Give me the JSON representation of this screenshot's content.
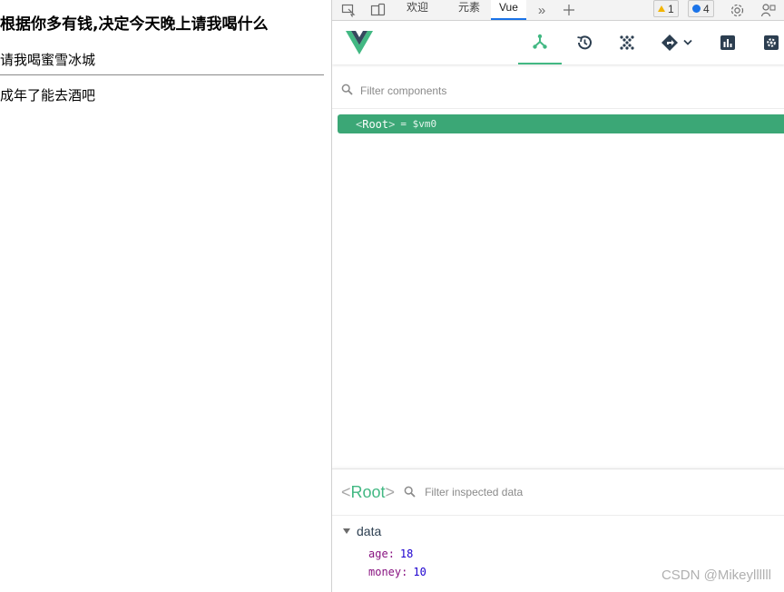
{
  "page": {
    "heading": "根据你多有钱,决定今天晚上请我喝什么",
    "line1": "请我喝蜜雪冰城",
    "line2": "成年了能去酒吧"
  },
  "devtools": {
    "tabs": [
      {
        "label": "欢迎",
        "active": false
      },
      {
        "label": "元素",
        "active": false
      },
      {
        "label": "Vue",
        "active": true
      }
    ],
    "warnings_count": "1",
    "messages_count": "4",
    "icons": [
      "inspect-icon",
      "device-toggle-icon",
      "more-tabs-icon",
      "add-tab-icon",
      "settings-icon",
      "dock-icon"
    ]
  },
  "vue": {
    "toolbar": [
      "components-icon",
      "timeline-icon",
      "vuex-icon",
      "router-icon",
      "performance-icon",
      "settings-icon"
    ],
    "filter_components_placeholder": "Filter components",
    "root_tag": "Root",
    "root_ref": "= $vm0",
    "inspector_title": "Root",
    "filter_inspected_placeholder": "Filter inspected data",
    "data_section_label": "data",
    "props": [
      {
        "key": "age",
        "value": "18"
      },
      {
        "key": "money",
        "value": "10"
      }
    ],
    "accent_color": "#42b883"
  },
  "watermark": "CSDN @Mikeyllllll"
}
